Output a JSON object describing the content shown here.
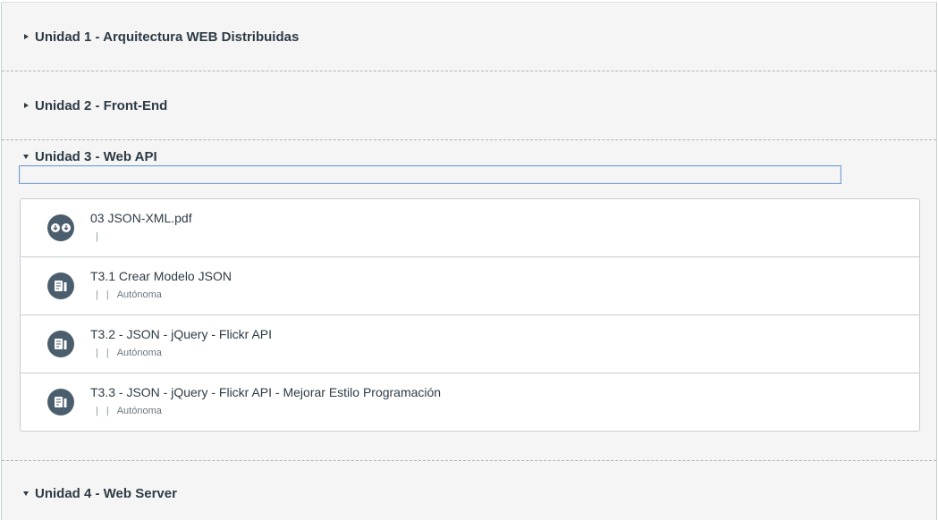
{
  "modules": [
    {
      "title": "Unidad 1 - Arquitectura WEB Distribuidas",
      "state": "collapsed"
    },
    {
      "title": "Unidad 2 - Front-End",
      "state": "collapsed"
    },
    {
      "title": "Unidad 3 - Web API",
      "state": "expanded",
      "items": [
        {
          "title": "03 JSON-XML.pdf",
          "icon": "download-attachment-icon",
          "meta": ""
        },
        {
          "title": "T3.1 Crear Modelo JSON",
          "icon": "assignment-icon",
          "meta": "Autónoma"
        },
        {
          "title": "T3.2 - JSON - jQuery - Flickr API",
          "icon": "assignment-icon",
          "meta": "Autónoma"
        },
        {
          "title": "T3.3 - JSON - jQuery - Flickr API - Mejorar Estilo Programación",
          "icon": "assignment-icon",
          "meta": "Autónoma"
        }
      ]
    },
    {
      "title": "Unidad 4 - Web Server",
      "state": "expanded"
    }
  ],
  "meta_separator": "|",
  "colors": {
    "background": "#f5f5f5",
    "text": "#2d3b45",
    "icon_bg": "#4b5e6d",
    "focus": "#7aa0cc"
  }
}
